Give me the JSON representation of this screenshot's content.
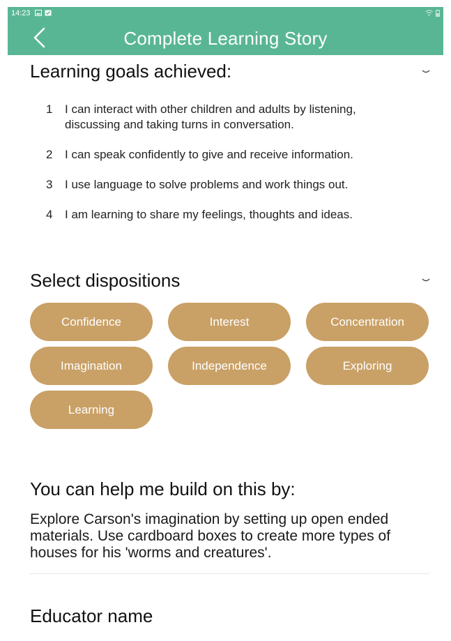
{
  "status_bar": {
    "time": "14:23"
  },
  "header": {
    "title": "Complete Learning Story"
  },
  "goals_section": {
    "title": "Learning goals achieved:",
    "items": [
      {
        "number": "1",
        "text": "I can interact with other children and adults by listening, discussing and taking turns in conversation."
      },
      {
        "number": "2",
        "text": "I can speak confidently to give and receive information."
      },
      {
        "number": "3",
        "text": "I use language to solve problems and work things out."
      },
      {
        "number": "4",
        "text": "I am learning to share my feelings, thoughts and ideas."
      }
    ]
  },
  "dispositions_section": {
    "title": "Select dispositions",
    "chips": [
      "Confidence",
      "Interest",
      "Concentration",
      "Imagination",
      "Independence",
      "Exploring",
      "Learning"
    ]
  },
  "help_section": {
    "title": "You can help me build on this by:",
    "text": "Explore Carson's imagination by setting up open ended materials. Use cardboard boxes to create more types of houses for his 'worms and creatures'."
  },
  "educator_section": {
    "title": "Educator name"
  },
  "colors": {
    "header_bg": "#59b695",
    "chip_bg": "#c9a066",
    "chip_text": "#ffffff"
  },
  "icons": {
    "back": "chevron-left-icon",
    "expand": "chevron-down-icon"
  }
}
